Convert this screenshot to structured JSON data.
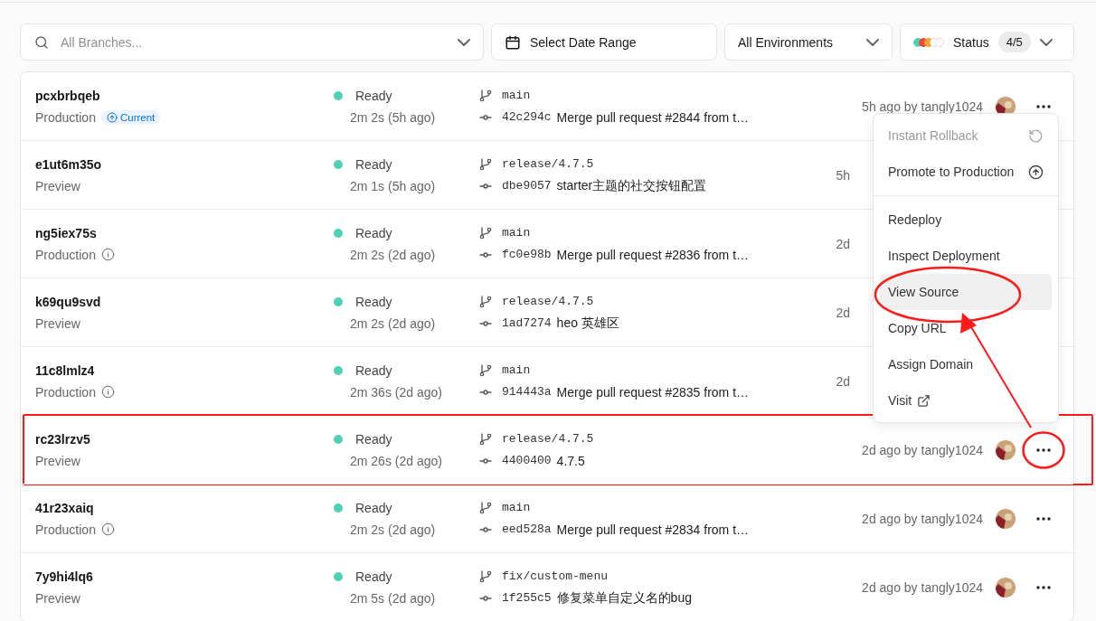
{
  "filters": {
    "branch_search": {
      "placeholder": "All Branches..."
    },
    "date_range": {
      "label": "Select Date Range"
    },
    "environment": {
      "label": "All Environments"
    },
    "status": {
      "label": "Status",
      "count": "4/5",
      "dots": [
        {
          "color": "#4fd1b5"
        },
        {
          "color": "#e5484d"
        },
        {
          "color": "#f5a524"
        },
        {
          "color": "#ffffff"
        },
        {
          "color": "#ffffff"
        }
      ]
    }
  },
  "deployments": [
    {
      "id": "pcxbrbqeb",
      "environment": "Production",
      "env_badge": {
        "kind": "current",
        "label": "Current"
      },
      "status": "Ready",
      "duration": "2m 2s (5h ago)",
      "branch": "main",
      "commit": "42c294c",
      "message": "Merge pull request #2844 from t…",
      "time": "5h ago by tangly1024",
      "actions_visible": true,
      "highlighted": false
    },
    {
      "id": "e1ut6m35o",
      "environment": "Preview",
      "status": "Ready",
      "duration": "2m 1s (5h ago)",
      "branch": "release/4.7.5",
      "commit": "dbe9057",
      "message": "starter主题的社交按钮配置",
      "time": "5h",
      "actions_visible": false,
      "highlighted": false
    },
    {
      "id": "ng5iex75s",
      "environment": "Production",
      "env_badge": {
        "kind": "info"
      },
      "status": "Ready",
      "duration": "2m 2s (2d ago)",
      "branch": "main",
      "commit": "fc0e98b",
      "message": "Merge pull request #2836 from t…",
      "time": "2d",
      "actions_visible": false,
      "highlighted": false
    },
    {
      "id": "k69qu9svd",
      "environment": "Preview",
      "status": "Ready",
      "duration": "2m 2s (2d ago)",
      "branch": "release/4.7.5",
      "commit": "1ad7274",
      "message": "heo 英雄区",
      "time": "2d",
      "actions_visible": false,
      "highlighted": false
    },
    {
      "id": "11c8lmlz4",
      "environment": "Production",
      "env_badge": {
        "kind": "info"
      },
      "status": "Ready",
      "duration": "2m 36s (2d ago)",
      "branch": "main",
      "commit": "914443a",
      "message": "Merge pull request #2835 from t…",
      "time": "2d",
      "actions_visible": false,
      "highlighted": false
    },
    {
      "id": "rc23lrzv5",
      "environment": "Preview",
      "status": "Ready",
      "duration": "2m 26s (2d ago)",
      "branch": "release/4.7.5",
      "commit": "4400400",
      "message": "4.7.5",
      "time": "2d ago by tangly1024",
      "actions_visible": true,
      "highlighted": true
    },
    {
      "id": "41r23xaiq",
      "environment": "Production",
      "env_badge": {
        "kind": "info"
      },
      "status": "Ready",
      "duration": "2m 2s (2d ago)",
      "branch": "main",
      "commit": "eed528a",
      "message": "Merge pull request #2834 from t…",
      "time": "2d ago by tangly1024",
      "actions_visible": true,
      "highlighted": false
    },
    {
      "id": "7y9hi4lq6",
      "environment": "Preview",
      "status": "Ready",
      "duration": "2m 5s (2d ago)",
      "branch": "fix/custom-menu",
      "commit": "1f255c5",
      "message": "修复菜单自定义名的bug",
      "time": "2d ago by tangly1024",
      "actions_visible": true,
      "highlighted": false
    }
  ],
  "context_menu": {
    "groups": [
      [
        {
          "label": "Instant Rollback",
          "kind": "rollback",
          "disabled": true,
          "selected": false
        },
        {
          "label": "Promote to Production",
          "kind": "promote",
          "disabled": false,
          "selected": false
        }
      ],
      [
        {
          "label": "Redeploy",
          "disabled": false,
          "selected": false
        },
        {
          "label": "Inspect Deployment",
          "disabled": false,
          "selected": false
        },
        {
          "label": "View Source",
          "disabled": false,
          "selected": true
        },
        {
          "label": "Copy URL",
          "disabled": false,
          "selected": false
        },
        {
          "label": "Assign Domain",
          "disabled": false,
          "selected": false
        },
        {
          "label": "Visit",
          "kind": "external",
          "disabled": false,
          "selected": false
        }
      ]
    ]
  }
}
